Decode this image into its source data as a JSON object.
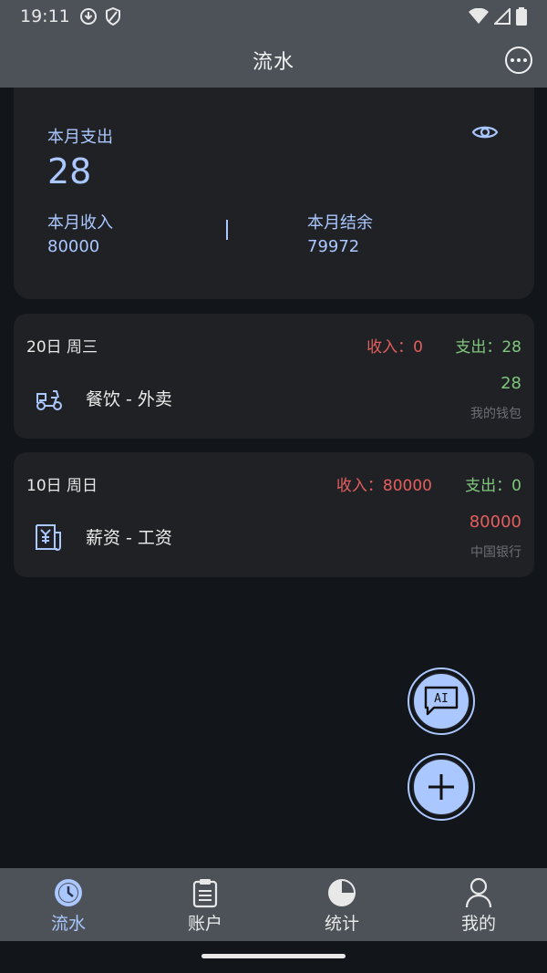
{
  "status_bar": {
    "time": "19:11"
  },
  "header": {
    "title": "流水"
  },
  "summary": {
    "expense_label": "本月支出",
    "expense_value": "28",
    "income_label": "本月收入",
    "income_value": "80000",
    "balance_label": "本月结余",
    "balance_value": "79972"
  },
  "days": [
    {
      "date": "20日 周三",
      "income": "收入：0",
      "expense": "支出：28",
      "transactions": [
        {
          "name": "餐饮 - 外卖",
          "amount": "28",
          "account": "我的钱包",
          "amount_color": "#7fc77d",
          "icon": "scooter-icon"
        }
      ]
    },
    {
      "date": "10日 周日",
      "income": "收入：80000",
      "expense": "支出：0",
      "transactions": [
        {
          "name": "薪资 - 工资",
          "amount": "80000",
          "account": "中国银行",
          "amount_color": "#e45e5e",
          "icon": "salary-receipt-icon"
        }
      ]
    }
  ],
  "fab": {
    "ai_label": "AI"
  },
  "bottom_nav": [
    {
      "label": "流水",
      "icon": "clock-icon",
      "active": true
    },
    {
      "label": "账户",
      "icon": "clipboard-icon",
      "active": false
    },
    {
      "label": "统计",
      "icon": "pie-chart-icon",
      "active": false
    },
    {
      "label": "我的",
      "icon": "person-icon",
      "active": false
    }
  ],
  "colors": {
    "accent": "#aac7ff",
    "income": "#e45e5e",
    "expense": "#7fc77d",
    "bar": "#4d5258",
    "background": "#121519",
    "card": "#202125"
  }
}
